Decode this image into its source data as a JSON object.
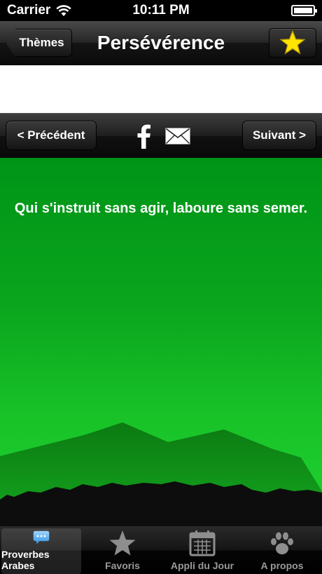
{
  "status_bar": {
    "carrier": "Carrier",
    "time": "10:11 PM"
  },
  "nav_bar": {
    "back_label": "Thèmes",
    "title": "Persévérence",
    "favorite_icon": "star-icon",
    "favorite_color": "#ffe400"
  },
  "toolbar": {
    "prev_label": "< Précédent",
    "next_label": "Suivant >",
    "share_icons": [
      "facebook-icon",
      "mail-icon"
    ]
  },
  "main": {
    "proverb": "Qui s'instruit sans agir, laboure sans semer.",
    "background_color": "#0aa51d"
  },
  "tab_bar": {
    "tabs": [
      {
        "label": "Proverbes Arabes",
        "icon": "speech-bubble-icon",
        "active": true
      },
      {
        "label": "Favoris",
        "icon": "star-icon",
        "active": false
      },
      {
        "label": "Appli du Jour",
        "icon": "calendar-icon",
        "active": false
      },
      {
        "label": "A propos",
        "icon": "paw-icon",
        "active": false
      }
    ]
  }
}
